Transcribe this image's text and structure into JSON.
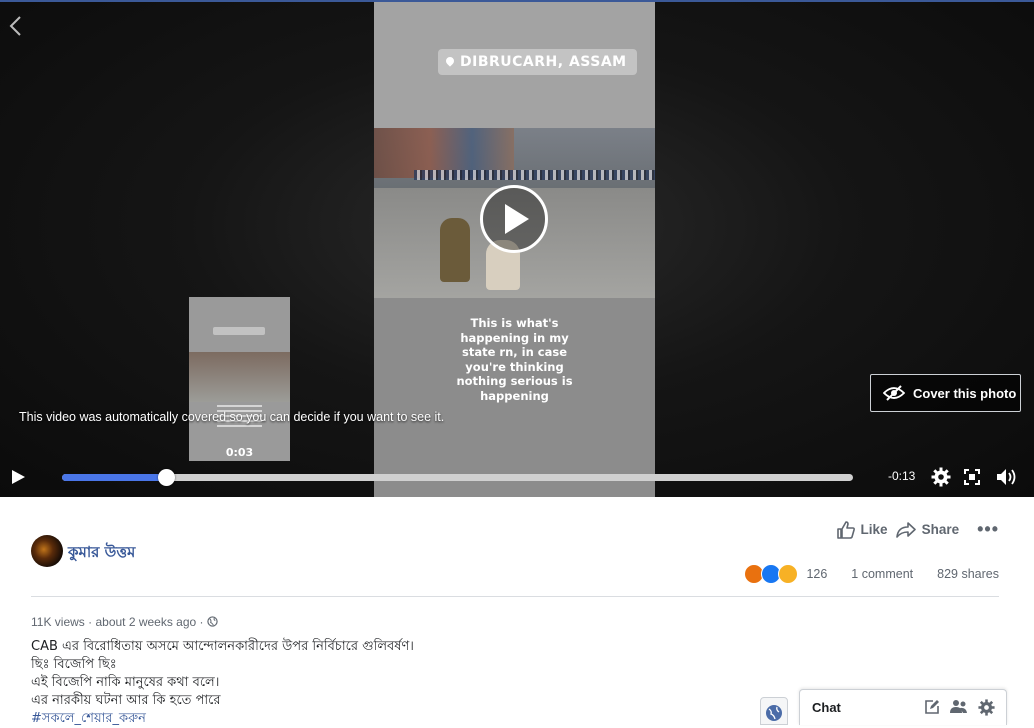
{
  "video": {
    "location_tag": "DIBRUCARH, ASSAM",
    "caption_lines": [
      "This is what's",
      "happening in my",
      "state rn, in case",
      "you're thinking",
      "nothing serious is",
      "happening"
    ],
    "covered_notice": "This video was automatically covered so you can decide if you want to see it.",
    "cover_button_label": "Cover this photo",
    "thumbnail_time": "0:03",
    "time_remaining": "-0:13",
    "progress": 0.131
  },
  "post": {
    "author": "কুমার উত্তম",
    "actions": {
      "like": "Like",
      "share": "Share"
    },
    "reaction_count": "126",
    "comments": "1 comment",
    "shares": "829 shares",
    "meta": "11K views · about 2 weeks ago ·",
    "body": [
      "CAB এর বিরোধিতায় অসমে আন্দোলনকারীদের উপর নির্বিচারে গুলিবর্ষণ।",
      "ছিঃ বিজেপি ছিঃ",
      "এই বিজেপি নাকি মানুষের কথা বলে।",
      "এর নারকীয় ঘটনা আর কি হতে পারে"
    ],
    "hashtag": "#সকলে_শেয়ার_করুন"
  },
  "chat": {
    "label": "Chat"
  },
  "colors": {
    "accent": "#4a76e8",
    "link": "#385898",
    "muted": "#606770"
  },
  "icons": [
    "back-icon",
    "play-icon",
    "eye-slash-icon",
    "settings-icon",
    "fullscreen-icon",
    "volume-icon",
    "like-icon",
    "share-icon",
    "more-icon",
    "globe-icon",
    "compose-icon",
    "contacts-icon",
    "gear-icon"
  ]
}
